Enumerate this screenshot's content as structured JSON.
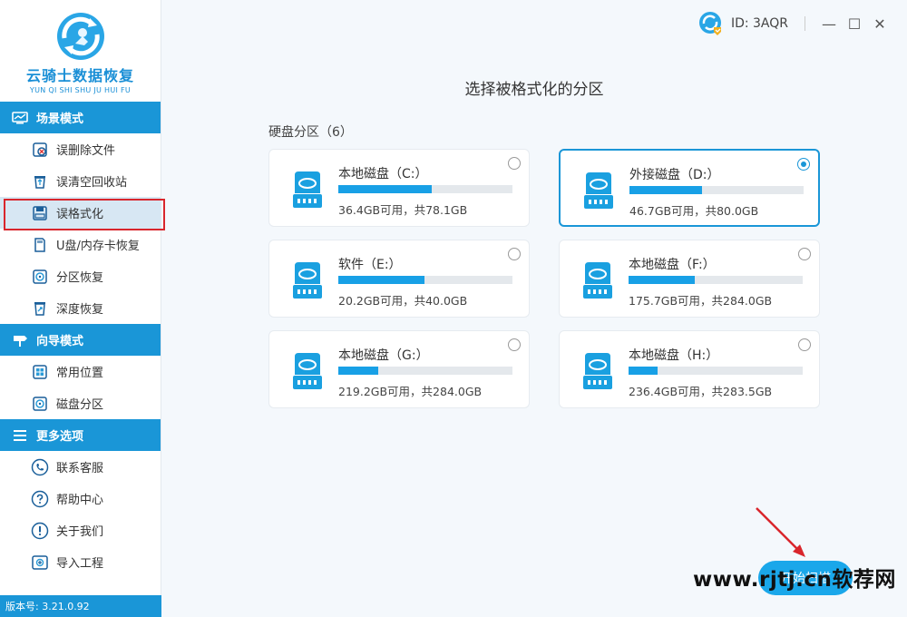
{
  "app": {
    "logo_title": "云骑士数据恢复",
    "logo_subtitle": "YUN QI SHI SHU JU HUI FU"
  },
  "user": {
    "id_label": "ID: 3AQR"
  },
  "window_controls": {
    "minimize": "—",
    "maximize": "☐",
    "close": "✕"
  },
  "sidebar": {
    "sections": [
      {
        "header": "场景模式",
        "icon": "scene-mode-icon",
        "items": [
          {
            "label": "误删除文件",
            "icon": "deleted-file-icon"
          },
          {
            "label": "误清空回收站",
            "icon": "recycle-bin-icon"
          },
          {
            "label": "误格式化",
            "icon": "format-disk-icon",
            "active": true
          },
          {
            "label": "U盘/内存卡恢复",
            "icon": "usb-card-icon"
          },
          {
            "label": "分区恢复",
            "icon": "partition-icon"
          },
          {
            "label": "深度恢复",
            "icon": "deep-recovery-icon"
          }
        ]
      },
      {
        "header": "向导模式",
        "icon": "guide-mode-icon",
        "items": [
          {
            "label": "常用位置",
            "icon": "windows-icon"
          },
          {
            "label": "磁盘分区",
            "icon": "disk-partition-icon"
          }
        ]
      },
      {
        "header": "更多选项",
        "icon": "menu-lines-icon",
        "items": [
          {
            "label": "联系客服",
            "icon": "phone-icon"
          },
          {
            "label": "帮助中心",
            "icon": "question-icon"
          },
          {
            "label": "关于我们",
            "icon": "info-icon"
          },
          {
            "label": "导入工程",
            "icon": "import-icon"
          }
        ]
      }
    ],
    "version": "版本号: 3.21.0.92"
  },
  "main": {
    "title": "选择被格式化的分区",
    "group_label": "硬盘分区（6）",
    "partitions": [
      {
        "name": "本地磁盘（C:）",
        "info": "36.4GB可用，共78.1GB",
        "used_fraction": 0.534,
        "selected": false
      },
      {
        "name": "外接磁盘（D:）",
        "info": "46.7GB可用，共80.0GB",
        "used_fraction": 0.416,
        "selected": true
      },
      {
        "name": "软件（E:）",
        "info": "20.2GB可用，共40.0GB",
        "used_fraction": 0.495,
        "selected": false
      },
      {
        "name": "本地磁盘（F:）",
        "info": "175.7GB可用，共284.0GB",
        "used_fraction": 0.381,
        "selected": false
      },
      {
        "name": "本地磁盘（G:）",
        "info": "219.2GB可用，共284.0GB",
        "used_fraction": 0.228,
        "selected": false
      },
      {
        "name": "本地磁盘（H:）",
        "info": "236.4GB可用，共283.5GB",
        "used_fraction": 0.166,
        "selected": false
      }
    ],
    "start_button": "开始扫描"
  },
  "watermark": "www.rjtj.cn软荐网",
  "colors": {
    "accent": "#1a96d7",
    "highlight_box": "#d9262c",
    "bar_fill": "#18a0e6"
  }
}
